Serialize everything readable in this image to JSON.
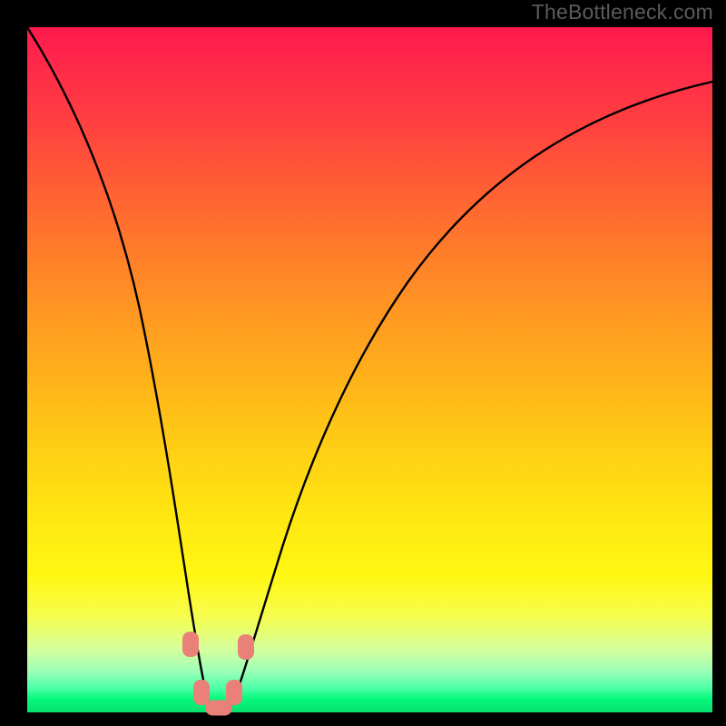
{
  "watermark": {
    "text": "TheBottleneck.com"
  },
  "colors": {
    "background": "#000000",
    "gradient_top": "#ff1a4d",
    "gradient_bottom": "#07e06e",
    "curve": "#000000",
    "marker": "#e98178",
    "watermark": "#5b5b5b"
  },
  "chart_data": {
    "type": "line",
    "title": "",
    "xlabel": "",
    "ylabel": "",
    "axes_visible": false,
    "grid": false,
    "x_range": [
      0,
      100
    ],
    "y_range": [
      0,
      100
    ],
    "note": "V-shaped bottleneck curve over rainbow vertical gradient. Axis scales are unlabeled; y interpreted as bottleneck percentage (0 bottom, 100 top). x interpreted as relative component performance (0–100). Curve reaches y≈0 near x≈27 and rises sharply on both sides.",
    "series": [
      {
        "name": "bottleneck-curve",
        "x": [
          0,
          5,
          10,
          14,
          18,
          21,
          23,
          25,
          26,
          27,
          28,
          29,
          31,
          34,
          38,
          44,
          52,
          62,
          75,
          88,
          100
        ],
        "y": [
          100,
          85,
          68,
          52,
          35,
          20,
          10,
          3,
          1,
          0,
          0,
          1,
          5,
          14,
          27,
          42,
          56,
          67,
          77,
          84,
          88
        ]
      }
    ],
    "markers": [
      {
        "name": "left-shoulder-upper",
        "x": 23.5,
        "y": 10,
        "shape": "pill-vertical"
      },
      {
        "name": "left-shoulder-lower",
        "x": 25.0,
        "y": 2.5,
        "shape": "pill-vertical"
      },
      {
        "name": "valley-floor",
        "x": 27.5,
        "y": 0.5,
        "shape": "pill-horizontal"
      },
      {
        "name": "right-shoulder-lower",
        "x": 30.0,
        "y": 2.5,
        "shape": "pill-vertical"
      },
      {
        "name": "right-shoulder-upper",
        "x": 31.5,
        "y": 9,
        "shape": "pill-vertical"
      }
    ]
  }
}
